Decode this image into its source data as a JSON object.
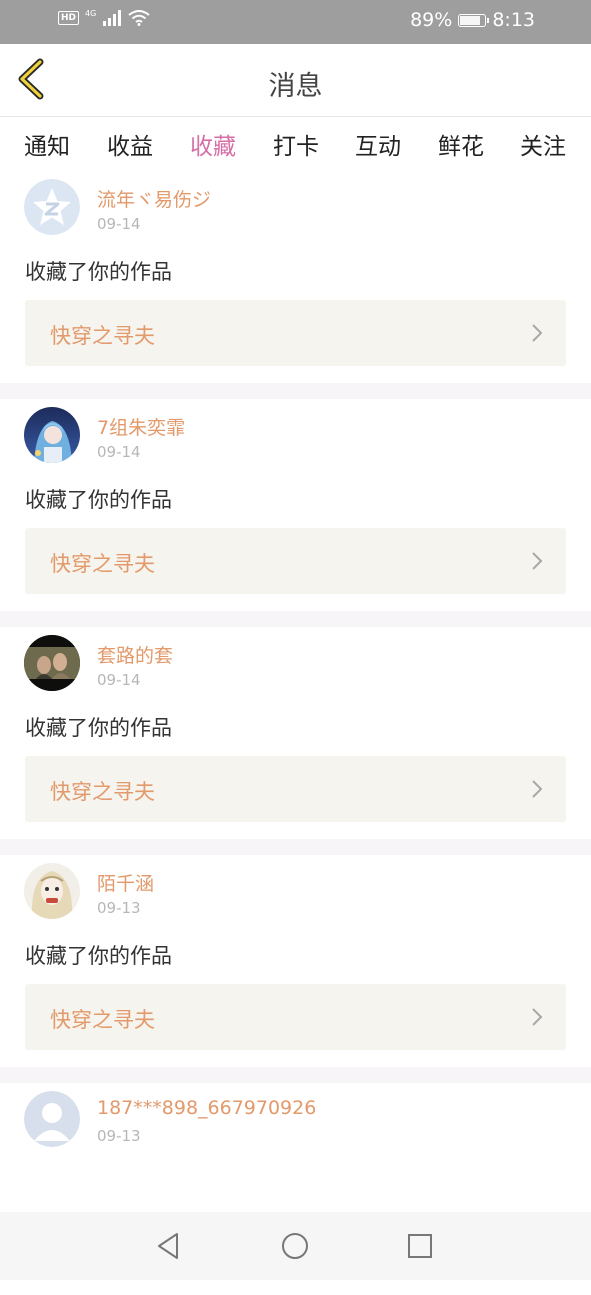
{
  "status_bar": {
    "left_icons": [
      "hd-icon",
      "4g-icon",
      "signal-icon",
      "wifi-icon"
    ],
    "hd_label": "HD",
    "network_label": "4G",
    "battery_percent": "89%",
    "battery_level": 0.89,
    "time": "8:13"
  },
  "header": {
    "title": "消息"
  },
  "tabs": [
    {
      "label": "通知"
    },
    {
      "label": "收益"
    },
    {
      "label": "收藏"
    },
    {
      "label": "打卡"
    },
    {
      "label": "互动"
    },
    {
      "label": "鲜花"
    },
    {
      "label": "关注"
    }
  ],
  "active_tab": "收藏",
  "colors": {
    "accent": "#d56fa6",
    "username": "#e3996a",
    "work_bg": "#f5f4ef"
  },
  "messages": [
    {
      "user": "流年ヾ易伤ジ",
      "date": "09-14",
      "action": "收藏了你的作品",
      "work": "快穿之寻夫",
      "avatar": "default-qq-avatar"
    },
    {
      "user": "7组朱奕霏",
      "date": "09-14",
      "action": "收藏了你的作品",
      "work": "快穿之寻夫",
      "avatar": "anime-girl-avatar"
    },
    {
      "user": "套路的套",
      "date": "09-14",
      "action": "收藏了你的作品",
      "work": "快穿之寻夫",
      "avatar": "couple-photo-avatar"
    },
    {
      "user": "陌千涵",
      "date": "09-13",
      "action": "收藏了你的作品",
      "work": "快穿之寻夫",
      "avatar": "sketch-girl-avatar"
    },
    {
      "user": "187***898_667970926",
      "date": "09-13",
      "action": "",
      "work": "",
      "avatar": "default-person-avatar"
    }
  ]
}
